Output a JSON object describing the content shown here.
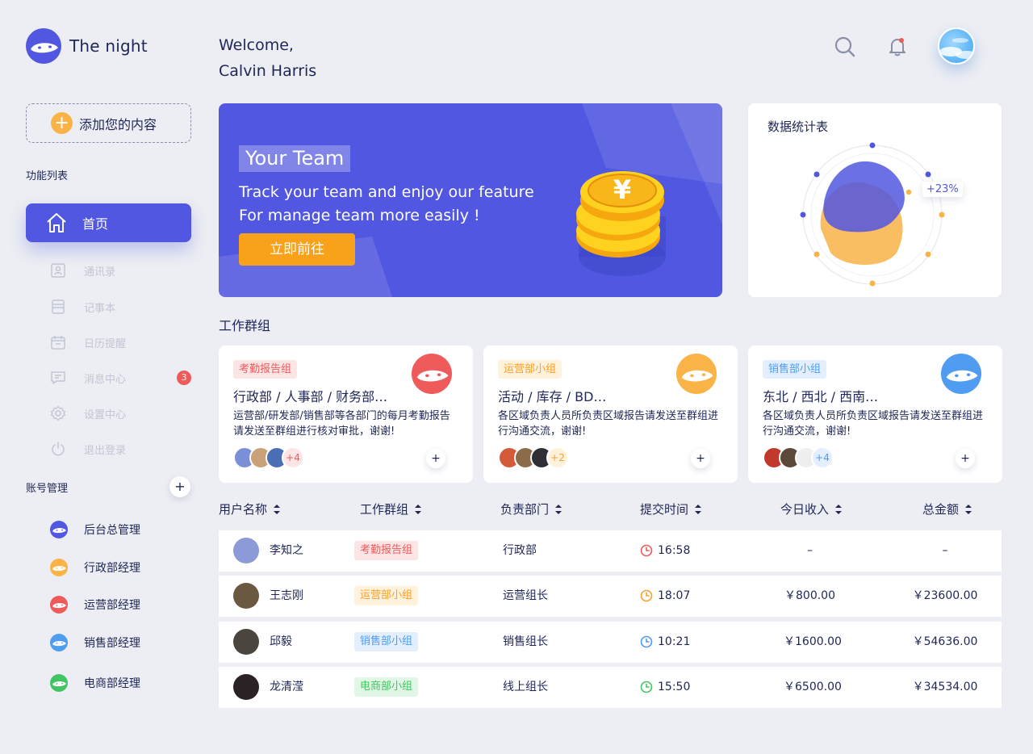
{
  "app": {
    "name": "The night"
  },
  "sidebar": {
    "add_label": "添加您的内容",
    "section_features": "功能列表",
    "active_item": "首页",
    "items": [
      {
        "label": "通讯录",
        "icon": "contacts-icon"
      },
      {
        "label": "记事本",
        "icon": "notebook-icon"
      },
      {
        "label": "日历提醒",
        "icon": "calendar-icon"
      },
      {
        "label": "消息中心",
        "icon": "message-icon",
        "badge": "3"
      },
      {
        "label": "设置中心",
        "icon": "gear-icon"
      },
      {
        "label": "退出登录",
        "icon": "power-icon"
      }
    ],
    "section_accounts": "账号管理",
    "accounts_add": "+",
    "accounts": [
      {
        "label": "后台总管理",
        "color": "#5157e0"
      },
      {
        "label": "行政部经理",
        "color": "#f9b346"
      },
      {
        "label": "运营部经理",
        "color": "#ef5a5a"
      },
      {
        "label": "销售部经理",
        "color": "#4f9cf0"
      },
      {
        "label": "电商部经理",
        "color": "#43c463"
      }
    ]
  },
  "header": {
    "greeting": "Welcome,",
    "user": "Calvin Harris"
  },
  "banner": {
    "title": "Your Team",
    "line1": "Track your team and enjoy our feature",
    "line2": "For manage team more easily !",
    "button": "立即前往"
  },
  "stats": {
    "title": "数据统计表",
    "change": "+23%"
  },
  "groups": {
    "title": "工作群组",
    "cards": [
      {
        "tag": "考勤报告组",
        "tag_color": "#ef5a5a",
        "tag_bg": "#fde5e5",
        "mascot_color": "#ef5a5a",
        "title": "行政部 / 人事部 / 财务部…",
        "desc": "运营部/研发部/销售部等各部门的每月考勤报告请发送至群组进行核对审批，谢谢!",
        "more": "+4",
        "more_color": "#ef5a5a",
        "more_bg": "#fde5e5",
        "plus": "+"
      },
      {
        "tag": "运营部小组",
        "tag_color": "#f9a12c",
        "tag_bg": "#fef2dd",
        "mascot_color": "#f9b346",
        "title": "活动 / 库存 / BD…",
        "desc": "各区域负责人员所负责区域报告请发送至群组进行沟通交流，谢谢!",
        "more": "+2",
        "more_color": "#f9a12c",
        "more_bg": "#fef2dd",
        "plus": "+"
      },
      {
        "tag": "销售部小组",
        "tag_color": "#4f9cf0",
        "tag_bg": "#e3efff",
        "mascot_color": "#4f9cf0",
        "title": "东北 / 西北 / 西南…",
        "desc": "各区域负责人员所负责区域报告请发送至群组进行沟通交流，谢谢!",
        "more": "+4",
        "more_color": "#4f9cf0",
        "more_bg": "#e3efff",
        "plus": "+"
      }
    ]
  },
  "table": {
    "columns": [
      "用户名称",
      "工作群组",
      "负责部门",
      "提交时间",
      "今日收入",
      "总金额"
    ],
    "rows": [
      {
        "name": "李知之",
        "group": "考勤报告组",
        "group_color": "#ef5a5a",
        "group_bg": "#fde5e5",
        "dept": "行政部",
        "time": "16:58",
        "clock_color": "#ef5a5a",
        "today": "–",
        "total": "–"
      },
      {
        "name": "王志刚",
        "group": "运营部小组",
        "group_color": "#f9a12c",
        "group_bg": "#fef2dd",
        "dept": "运营组长",
        "time": "18:07",
        "clock_color": "#f9a12c",
        "today": "￥800.00",
        "total": "￥23600.00"
      },
      {
        "name": "邱毅",
        "group": "销售部小组",
        "group_color": "#4f9cf0",
        "group_bg": "#e3efff",
        "dept": "销售组长",
        "time": "10:21",
        "clock_color": "#4f9cf0",
        "today": "￥1600.00",
        "total": "￥54636.00"
      },
      {
        "name": "龙清滢",
        "group": "电商部小组",
        "group_color": "#43c463",
        "group_bg": "#e1f7e5",
        "dept": "线上组长",
        "time": "15:50",
        "clock_color": "#43c463",
        "today": "￥6500.00",
        "total": "￥34534.00"
      }
    ]
  },
  "colors": {
    "primary": "#5157e0",
    "accent": "#f8a21a",
    "background": "#eceef3"
  }
}
